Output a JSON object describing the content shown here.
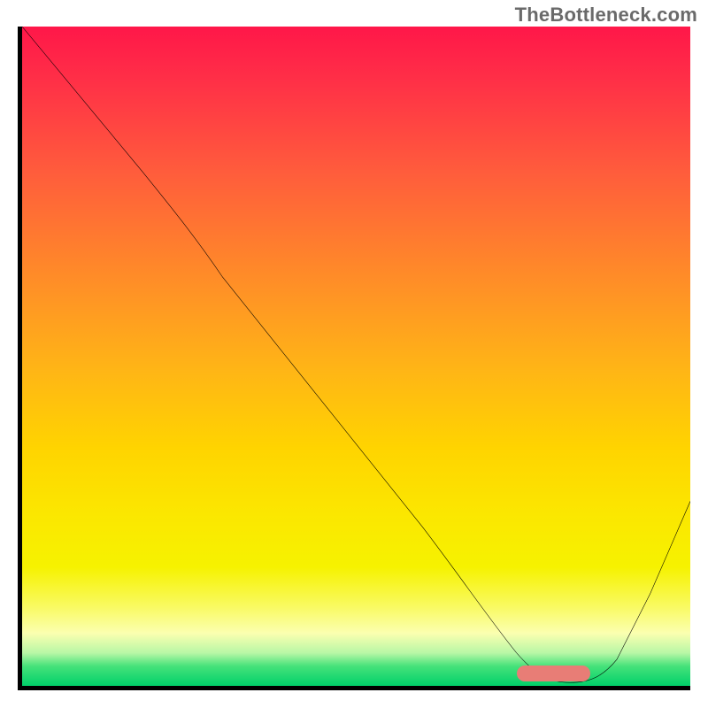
{
  "attribution": "TheBottleneck.com",
  "colors": {
    "gradient_top": "#ff1749",
    "gradient_mid": "#ffd400",
    "gradient_bottom": "#00d06a",
    "curve_stroke": "#000000",
    "indicator": "#e87d76",
    "axis": "#000000"
  },
  "chart_data": {
    "type": "line",
    "title": "",
    "xlabel": "",
    "ylabel": "",
    "xlim": [
      0,
      100
    ],
    "ylim": [
      0,
      100
    ],
    "grid": false,
    "series": [
      {
        "name": "bottleneck-curve",
        "x": [
          0,
          18,
          30,
          45,
          60,
          70,
          77,
          82,
          88,
          94,
          100
        ],
        "y": [
          100,
          78,
          62,
          43,
          24,
          10,
          2,
          0,
          2,
          14,
          28
        ]
      }
    ],
    "annotations": [
      {
        "name": "optimal-range-indicator",
        "type": "hbar",
        "x_start": 74,
        "x_end": 85,
        "y": 1.2
      }
    ]
  }
}
